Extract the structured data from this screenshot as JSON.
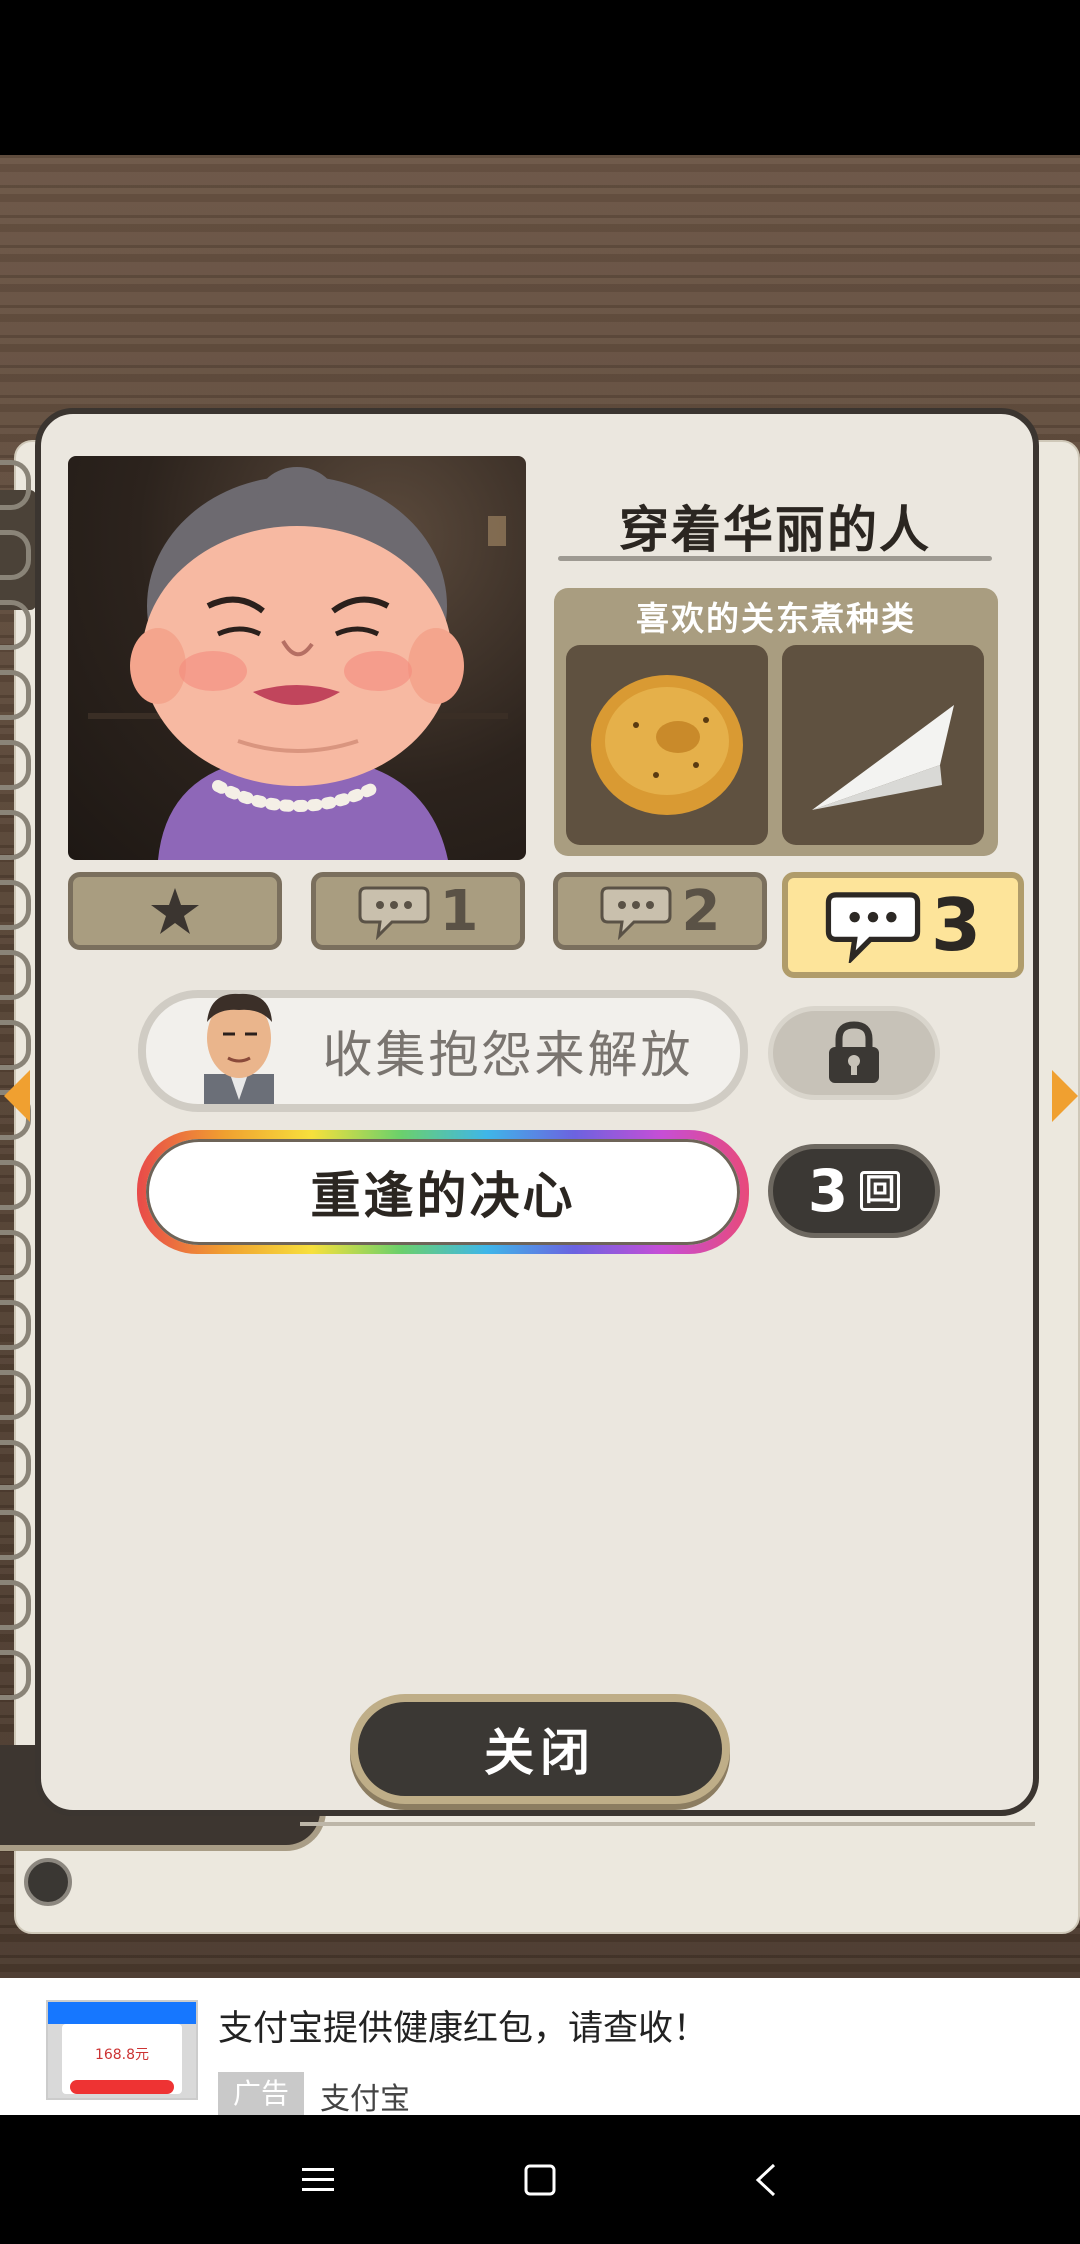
{
  "character": {
    "name": "穿着华丽的人",
    "favorite_title": "喜欢的关东煮种类",
    "favorites": [
      {
        "icon": "fried-fishcake-ball-icon"
      },
      {
        "icon": "hanpen-triangle-icon"
      }
    ]
  },
  "tabs": [
    {
      "icon": "star-icon",
      "label": ""
    },
    {
      "icon": "speech-bubble-icon",
      "label": "1"
    },
    {
      "icon": "speech-bubble-icon",
      "label": "2"
    },
    {
      "icon": "speech-bubble-icon",
      "label": "3",
      "active": true
    }
  ],
  "episodes": {
    "locked_label": "收集抱怨来解放",
    "locked_icon": "lock-icon",
    "main_label": "重逢的决心",
    "count": "3",
    "count_unit": "回"
  },
  "close_label": "关闭",
  "ad": {
    "title": "支付宝提供健康红包，请查收！",
    "tag": "广告",
    "source": "支付宝",
    "thumb_text": "168.8元"
  },
  "colors": {
    "card": "#ebe7df",
    "active_tab": "#fde49a",
    "panel": "#a99d80",
    "dark_button": "#3b3834"
  }
}
